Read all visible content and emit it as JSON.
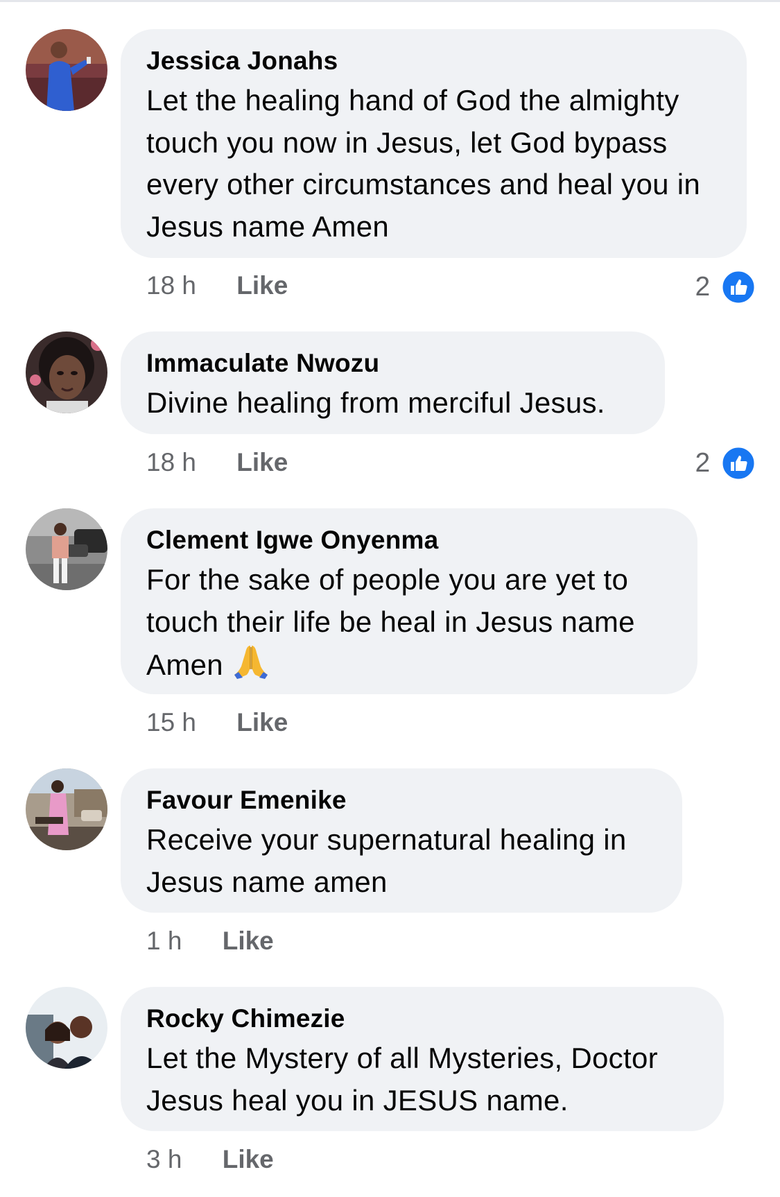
{
  "comments": [
    {
      "author": "Jessica Jonahs",
      "text": "Let the healing hand of God the almighty touch you now in Jesus, let God bypass every other circumstances and heal you in Jesus name Amen",
      "time": "18 h",
      "like_label": "Like",
      "reaction_count": "2",
      "reaction_icon": "like-reaction-icon"
    },
    {
      "author": "Immaculate Nwozu",
      "text": "Divine healing from merciful Jesus.",
      "time": "18 h",
      "like_label": "Like",
      "reaction_count": "2",
      "reaction_icon": "like-reaction-icon"
    },
    {
      "author": "Clement Igwe Onyenma",
      "text": "For the sake of people you are yet to touch their life be heal in Jesus name Amen",
      "emoji": "folded-hands-emoji",
      "time": "15 h",
      "like_label": "Like"
    },
    {
      "author": "Favour Emenike",
      "text": "Receive your supernatural healing in Jesus name amen",
      "time": "1 h",
      "like_label": "Like"
    },
    {
      "author": "Rocky Chimezie",
      "text": "Let the Mystery of all Mysteries, Doctor Jesus heal you in JESUS name.",
      "time": "3 h",
      "like_label": "Like"
    }
  ],
  "colors": {
    "bubble": "#f0f2f5",
    "meta_text": "#65676b",
    "like_blue": "#1877f2"
  }
}
